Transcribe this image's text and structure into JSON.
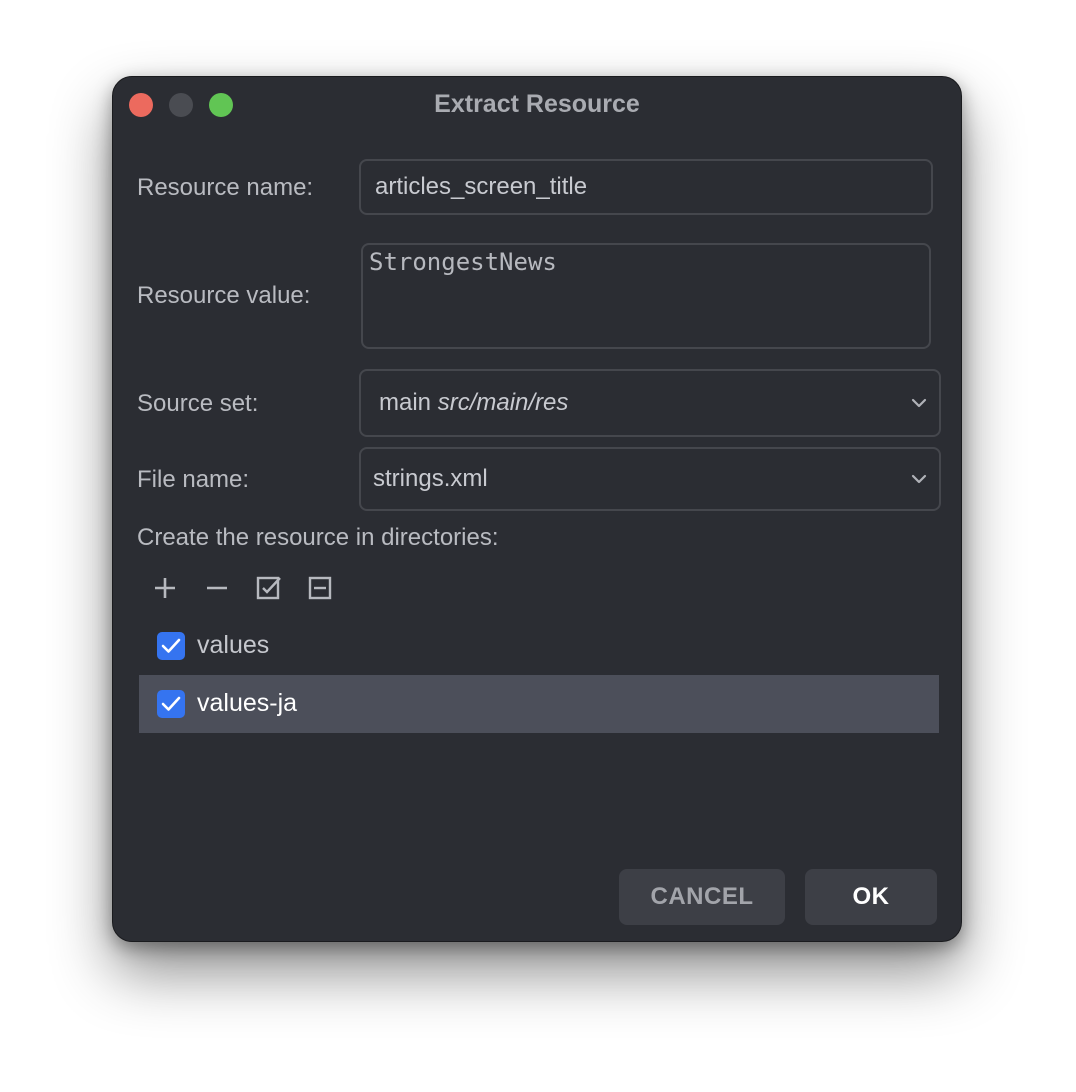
{
  "window": {
    "title": "Extract Resource",
    "controls": {
      "close": "close",
      "minimize": "minimize",
      "maximize": "maximize"
    }
  },
  "form": {
    "resource_name": {
      "label": "Resource name:",
      "value": "articles_screen_title"
    },
    "resource_value": {
      "label": "Resource value:",
      "value": "StrongestNews"
    },
    "source_set": {
      "label": "Source set:",
      "value": "main",
      "path": "src/main/res"
    },
    "file_name": {
      "label": "File name:",
      "value": "strings.xml"
    }
  },
  "directories": {
    "label": "Create the resource in directories:",
    "toolbar": [
      "add-icon",
      "remove-icon",
      "select-all-icon",
      "unselect-all-icon"
    ],
    "items": [
      {
        "label": "values",
        "checked": true,
        "selected": false
      },
      {
        "label": "values-ja",
        "checked": true,
        "selected": true
      }
    ]
  },
  "buttons": {
    "cancel": "CANCEL",
    "ok": "OK"
  },
  "colors": {
    "background": "#2b2d33",
    "accent": "#3574f0",
    "close": "#ec6a5e",
    "maximize": "#61c554",
    "selection": "#4c4f5a"
  }
}
